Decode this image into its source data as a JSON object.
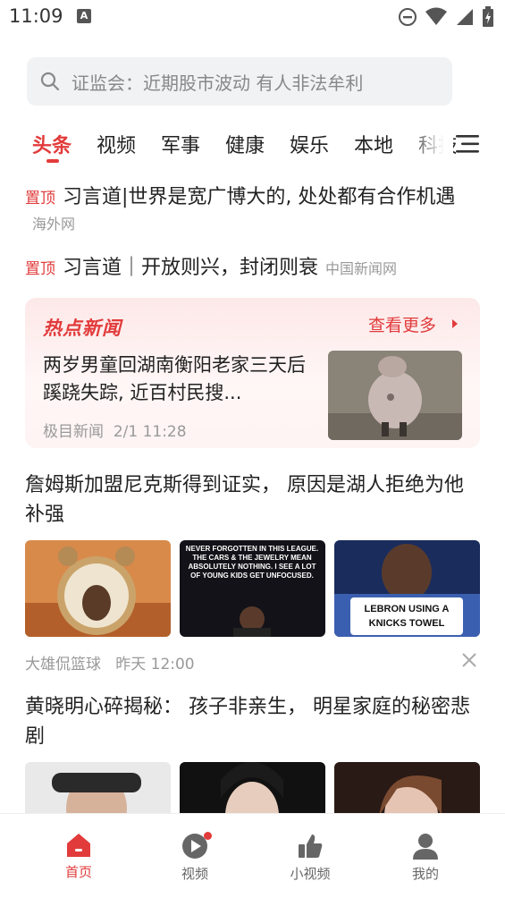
{
  "status_bar": {
    "time": "11:09",
    "notification_badge": "A"
  },
  "search": {
    "placeholder": "证监会：近期股市波动 有人非法牟利"
  },
  "tabs": [
    {
      "label": "头条",
      "active": true
    },
    {
      "label": "视频"
    },
    {
      "label": "军事"
    },
    {
      "label": "健康"
    },
    {
      "label": "娱乐"
    },
    {
      "label": "本地"
    },
    {
      "label": "科技"
    }
  ],
  "pinned": [
    {
      "tag": "置顶",
      "title": "习言道|世界是宽广博大的, 处处都有合作机遇",
      "source": "海外网"
    },
    {
      "tag": "置顶",
      "title": "习言道｜开放则兴，封闭则衰",
      "source": "中国新闻网"
    }
  ],
  "hot_news": {
    "header": "热点新闻",
    "more": "查看更多",
    "title": "两岁男童回湖南衡阳老家三天后蹊跷失踪, 近百村民搜...",
    "source": "极目新闻",
    "time": "2/1 11:28"
  },
  "articles": [
    {
      "title": "詹姆斯加盟尼克斯得到证实， 原因是湖人拒绝为他补强",
      "source": "大雄侃篮球",
      "time": "昨天 12:00",
      "thumb_texts": [
        "NEVER FORGOTTEN IN THIS LEAGUE. THE CARS & THE JEWELRY MEAN ABSOLUTELY NOTHING. I SEE A LOT OF YOUNG KIDS GET UNFOCUSED.",
        "LEBRON USING A KNICKS TOWEL"
      ]
    },
    {
      "title": "黄晓明心碎揭秘： 孩子非亲生， 明星家庭的秘密悲剧"
    }
  ],
  "bottom_nav": [
    {
      "label": "首页",
      "icon": "home-icon",
      "active": true
    },
    {
      "label": "视频",
      "icon": "play-icon"
    },
    {
      "label": "小视频",
      "icon": "thumbs-up-icon"
    },
    {
      "label": "我的",
      "icon": "user-icon"
    }
  ],
  "colors": {
    "accent": "#e23b3b",
    "muted": "#999999"
  }
}
